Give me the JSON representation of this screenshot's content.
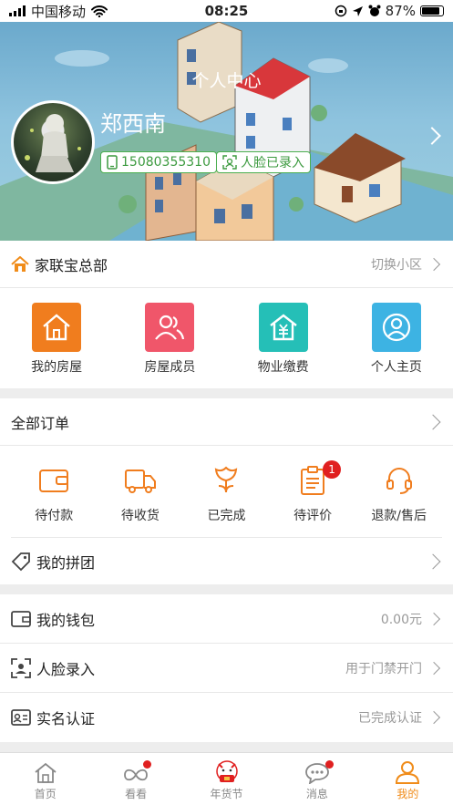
{
  "status_bar": {
    "carrier": "中国移动",
    "time": "08:25",
    "battery": "87%"
  },
  "header": {
    "title": "个人中心"
  },
  "profile": {
    "name": "郑西南",
    "phone": "15080355310",
    "face_status": "人脸已录入"
  },
  "community": {
    "name": "家联宝总部",
    "switch_label": "切换小区"
  },
  "quick_actions": [
    {
      "label": "我的房屋",
      "icon": "house-icon",
      "color": "#f07d1e"
    },
    {
      "label": "房屋成员",
      "icon": "members-icon",
      "color": "#f0566a"
    },
    {
      "label": "物业缴费",
      "icon": "fee-icon",
      "color": "#25bfb7"
    },
    {
      "label": "个人主页",
      "icon": "person-icon",
      "color": "#3db3e3"
    }
  ],
  "orders": {
    "title": "全部订单",
    "items": [
      {
        "label": "待付款",
        "icon": "wallet-icon"
      },
      {
        "label": "待收货",
        "icon": "truck-icon"
      },
      {
        "label": "已完成",
        "icon": "flower-icon"
      },
      {
        "label": "待评价",
        "icon": "clipboard-icon",
        "badge": "1"
      },
      {
        "label": "退款/售后",
        "icon": "headset-icon"
      }
    ]
  },
  "group_buy": {
    "label": "我的拼团"
  },
  "menu": [
    {
      "label": "我的钱包",
      "value": "0.00元",
      "icon": "wallet-outline-icon"
    },
    {
      "label": "人脸录入",
      "value": "用于门禁开门",
      "icon": "face-scan-icon"
    },
    {
      "label": "实名认证",
      "value": "已完成认证",
      "icon": "id-card-icon"
    }
  ],
  "tabbar": [
    {
      "label": "首页",
      "icon": "home-tab-icon"
    },
    {
      "label": "看看",
      "icon": "infinity-icon",
      "dot": true
    },
    {
      "label": "年货节",
      "icon": "festival-icon"
    },
    {
      "label": "消息",
      "icon": "message-icon",
      "dot": true
    },
    {
      "label": "我的",
      "icon": "profile-tab-icon",
      "active": true
    }
  ],
  "colors": {
    "accent": "#f08c1a",
    "badge": "#e02020",
    "chip_green": "#4caf50"
  }
}
